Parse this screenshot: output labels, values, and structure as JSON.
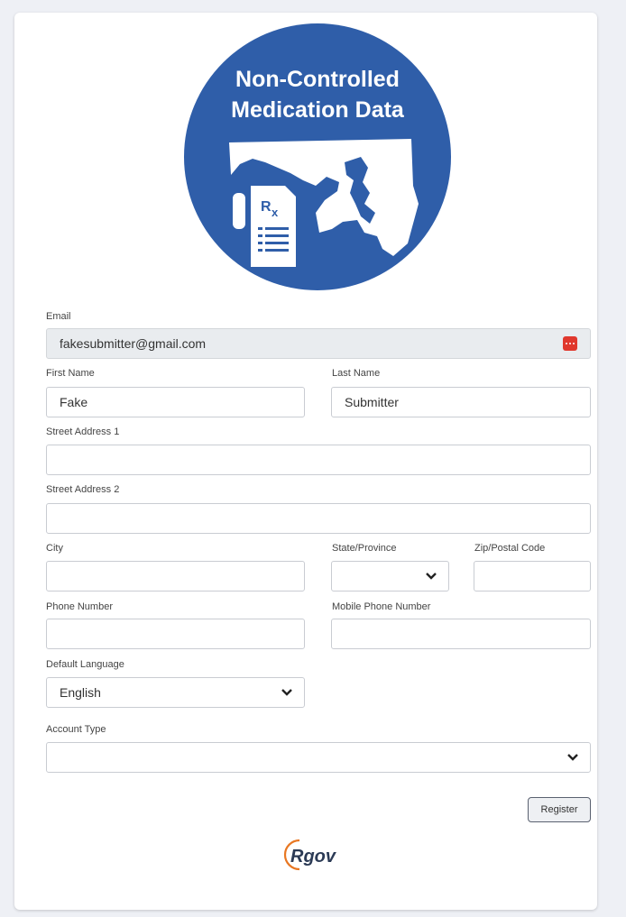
{
  "logo": {
    "line1": "Non-Controlled",
    "line2": "Medication Data",
    "rx": "Rx",
    "brand_color": "#2f5ea9"
  },
  "form": {
    "email": {
      "label": "Email",
      "value": "fakesubmitter@gmail.com"
    },
    "first_name": {
      "label": "First Name",
      "value": "Fake"
    },
    "last_name": {
      "label": "Last Name",
      "value": "Submitter"
    },
    "street1": {
      "label": "Street Address 1",
      "value": ""
    },
    "street2": {
      "label": "Street Address 2",
      "value": ""
    },
    "city": {
      "label": "City",
      "value": ""
    },
    "state": {
      "label": "State/Province",
      "value": ""
    },
    "zip": {
      "label": "Zip/Postal Code",
      "value": ""
    },
    "phone": {
      "label": "Phone Number",
      "value": ""
    },
    "mobile": {
      "label": "Mobile Phone Number",
      "value": ""
    },
    "language": {
      "label": "Default Language",
      "value": "English"
    },
    "account_type": {
      "label": "Account Type",
      "value": ""
    },
    "register_label": "Register"
  },
  "footer": {
    "brand": "Rgov",
    "icons": {
      "password": "password-dots-icon",
      "dropdown": "chevron-down-icon"
    },
    "accent_color": "#e87722"
  }
}
